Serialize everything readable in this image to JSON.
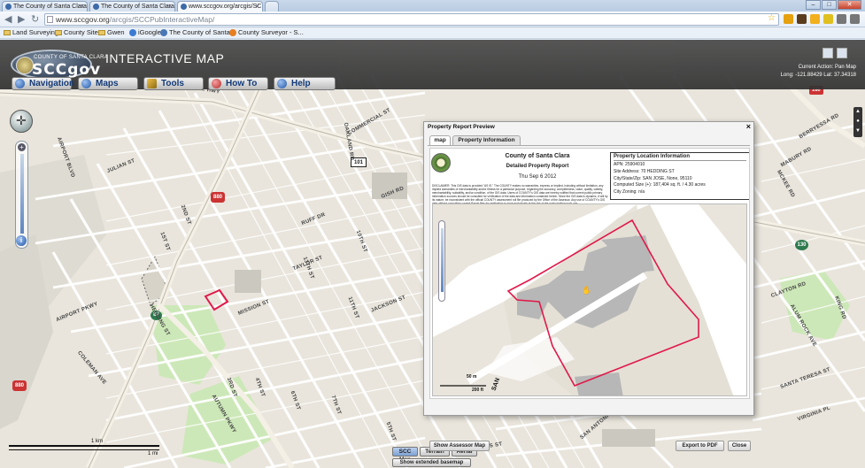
{
  "browser": {
    "tabs": [
      {
        "label": "The County of Santa Clara"
      },
      {
        "label": "The County of Santa Clara"
      },
      {
        "label": "www.sccgov.org/arcgis/SC"
      }
    ],
    "url": {
      "host": "www.sccgov.org",
      "path": "/arcgis/SCCPubInteractiveMap/"
    },
    "bookmarks": [
      "Land Surveying",
      "County Sites",
      "Gwen",
      "iGoogle",
      "The County of Santa...",
      "County Surveyor - S..."
    ]
  },
  "app": {
    "logo_top": "COUNTY OF SANTA CLARA",
    "logo_main": "SCCgov",
    "title": "INTERACTIVE MAP",
    "current_action": "Current Action: Pan Map",
    "coords": "Long: -121.88429 Lat: 37.34318",
    "menu": [
      "Navigation",
      "Maps",
      "Tools",
      "How To",
      "Help"
    ]
  },
  "map": {
    "scale_km": "1 km",
    "scale_mi": "1 mi",
    "basemap_buttons": [
      "SCC Map",
      "Terrain",
      "Aerial"
    ],
    "basemap_extended": "Show extended basemap",
    "shields": {
      "i880a": "880",
      "i880b": "880",
      "us101": "101",
      "sr87": "87",
      "sr130": "130",
      "i280": "280"
    },
    "streets": [
      "AIRPORT BLVD",
      "AIRPORT PKWY",
      "BAYSHORE HWY",
      "COLEMAN AVE",
      "HEDDING ST",
      "MISSION ST",
      "JACKSON ST",
      "TAYLOR ST",
      "COMMERCIAL ST",
      "OAKLAND RD",
      "GISH RD",
      "RUFF DR",
      "13TH ST",
      "10TH ST",
      "11TH ST",
      "7TH ST",
      "6TH ST",
      "1ST ST",
      "2ND ST",
      "3RD ST",
      "4TH ST",
      "5TH ST",
      "AUTUMN PKWY",
      "SAN ANTONIO ST",
      "ST JAMES ST",
      "JULIAN ST",
      "BERRYESSA RD",
      "MABURY RD",
      "CLAYTON RD",
      "ALUM ROCK AVE",
      "KING RD",
      "SANTA TERESA ST",
      "VIRGINIA PL",
      "MCKEE RD",
      "SAN JOSE"
    ]
  },
  "modal": {
    "title": "Property Report Preview",
    "tabs": [
      "map",
      "Property Information"
    ],
    "report_title": "County of Santa Clara",
    "report_subtitle": "Detailed Property Report",
    "report_date": "Thu Sep 6 2012",
    "disclaimer": "DISCLAIMER: This GIS data is provided \"AS IS.\" The COUNTY makes no warranties, express or implied, including without limitation, any implied warranties of merchantability and/or fitness for a particular purpose, regarding the accuracy, completeness, value, quality, validity, merchantability, suitability, and/or condition, of the GIS data. Users of COUNTY's GIS data are hereby notified that current public primary information sources should be consulted for verification of the data and information contained herein. Since the GIS data is dynamic, it will by its nature, be inconsistent with the official COUNTY assessment roll file produced by the Office of the Assessor. Any use of COUNTY's GIS data without consulting current Parcel files for verification is done exclusively at the risk of the party making such use.",
    "location": {
      "title": "Property Location Information",
      "apn": "APN: 25904010",
      "address": "Site Address: 70 HEDDING ST",
      "city": "City/State/Zip: SAN JOSE, None, 95110",
      "size": "Computed Size (+): 187,404 sq. ft. / 4.30 acres",
      "zoning": "City Zoning: n/a"
    },
    "map_scale_m": "50 m",
    "map_scale_ft": "200 ft",
    "map_label": "SAN",
    "buttons": {
      "assessor": "Show Assessor Map",
      "pdf": "Export to PDF",
      "close": "Close"
    },
    "close_glyph": "×"
  },
  "colors": {
    "parcel_outline": "#e0194a",
    "park_green": "#cde8b8",
    "road_white": "#ffffff",
    "header_bg": "#3a3a3a"
  }
}
